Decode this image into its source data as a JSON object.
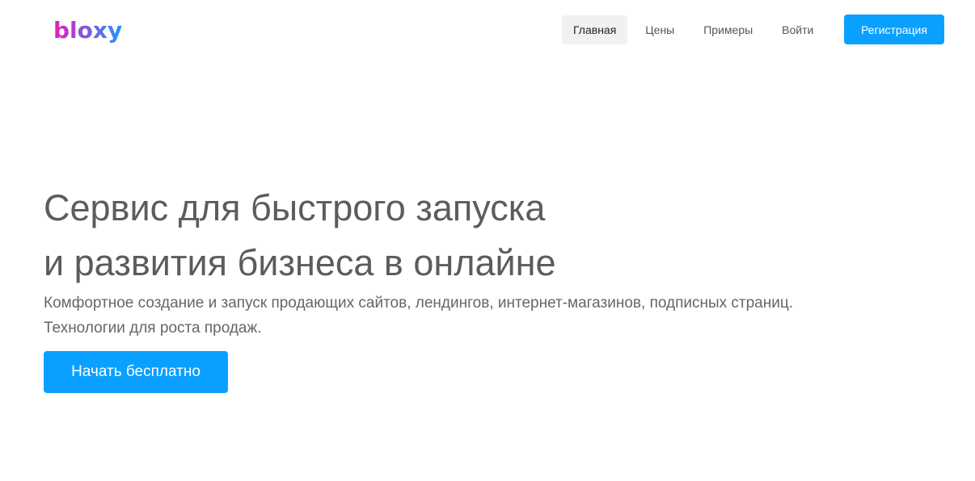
{
  "header": {
    "logo_text": "bloxy",
    "nav": [
      {
        "label": "Главная",
        "active": true
      },
      {
        "label": "Цены",
        "active": false
      },
      {
        "label": "Примеры",
        "active": false
      },
      {
        "label": "Войти",
        "active": false
      }
    ],
    "register_label": "Регистрация"
  },
  "hero": {
    "title_line1": "Сервис для быстрого запуска",
    "title_line2": "и развития бизнеса в онлайне",
    "subtitle_line1": "Комфортное создание и запуск продающих сайтов, лендингов, интернет-магазинов, подписных страниц.",
    "subtitle_line2": "Технологии для роста продаж.",
    "cta_label": "Начать бесплатно"
  },
  "colors": {
    "accent": "#0aa0ff",
    "logo_gradient_start": "#e61eb4",
    "logo_gradient_end": "#1e96ff",
    "title_text": "#5c5c5c"
  }
}
